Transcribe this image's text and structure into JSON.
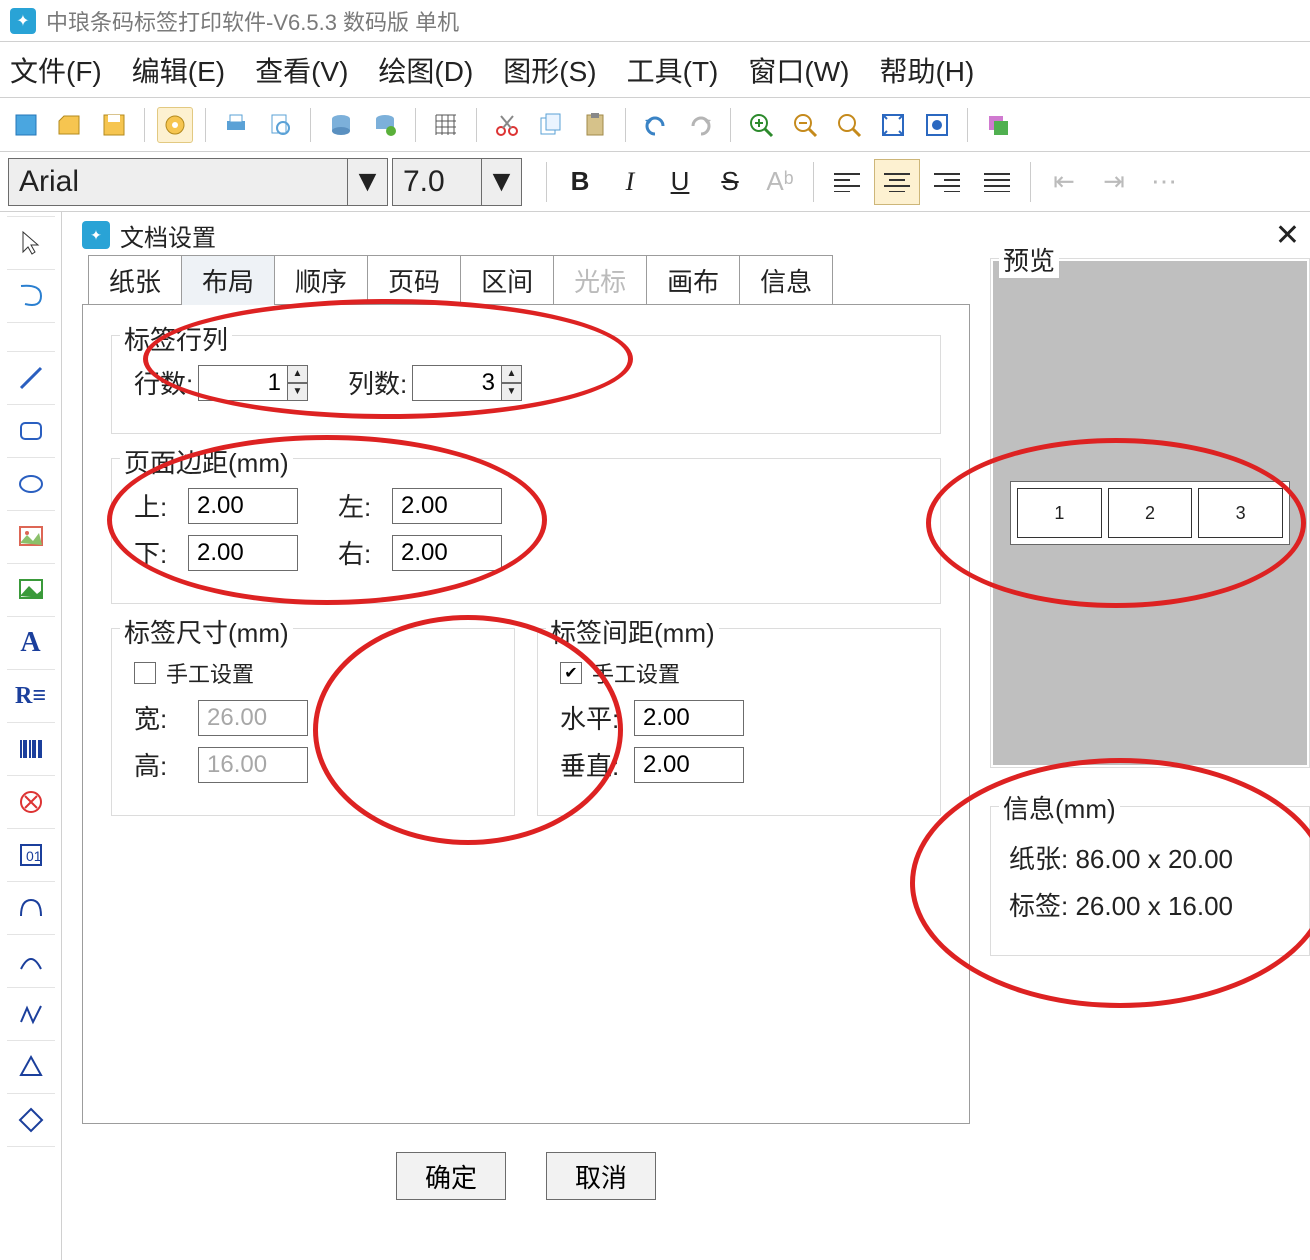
{
  "window": {
    "title": "中琅条码标签打印软件-V6.5.3 数码版 单机"
  },
  "menubar": {
    "file": "文件(F)",
    "edit": "编辑(E)",
    "view": "查看(V)",
    "draw": "绘图(D)",
    "shape": "图形(S)",
    "tool": "工具(T)",
    "window": "窗口(W)",
    "help": "帮助(H)"
  },
  "formatbar": {
    "font_name": "Arial",
    "font_size": "7.0",
    "bold": "B",
    "italic": "I",
    "underline": "U",
    "strike": "S"
  },
  "dialog": {
    "title": "文档设置",
    "tabs": {
      "paper": "纸张",
      "layout": "布局",
      "order": "顺序",
      "pageno": "页码",
      "range": "区间",
      "cursor": "光标",
      "canvas": "画布",
      "info": "信息"
    },
    "rows_cols": {
      "legend": "标签行列",
      "rows_label": "行数:",
      "rows_value": "1",
      "cols_label": "列数:",
      "cols_value": "3"
    },
    "margins": {
      "legend": "页面边距(mm)",
      "top_label": "上:",
      "top_value": "2.00",
      "left_label": "左:",
      "left_value": "2.00",
      "bottom_label": "下:",
      "bottom_value": "2.00",
      "right_label": "右:",
      "right_value": "2.00"
    },
    "label_size": {
      "legend": "标签尺寸(mm)",
      "manual_label": "手工设置",
      "width_label": "宽:",
      "width_value": "26.00",
      "height_label": "高:",
      "height_value": "16.00"
    },
    "label_gap": {
      "legend": "标签间距(mm)",
      "manual_label": "手工设置",
      "h_label": "水平:",
      "h_value": "2.00",
      "v_label": "垂直:",
      "v_value": "2.00"
    },
    "preview": {
      "legend": "预览",
      "cells": [
        "1",
        "2",
        "3"
      ]
    },
    "info": {
      "legend": "信息(mm)",
      "paper": "纸张:  86.00 x 20.00",
      "label": "标签:  26.00 x 16.00"
    },
    "ok": "确定",
    "cancel": "取消"
  }
}
